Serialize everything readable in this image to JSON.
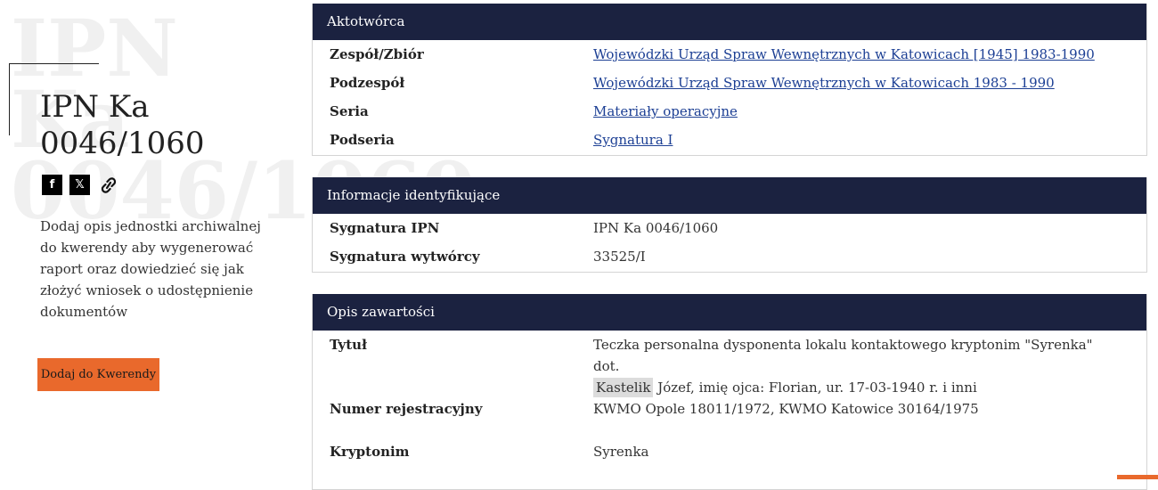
{
  "unit": {
    "watermark": "IPN Ka\n0046/1060",
    "title": "IPN Ka\n0046/1060",
    "description": "Dodaj opis jednostki archiwalnej do kwerendy aby wygenerować raport oraz dowiedzieć się jak złożyć wniosek o udostępnienie dokumentów",
    "add_button": "Dodaj do Kwerendy"
  },
  "share": {
    "facebook_glyph": "f",
    "x_glyph": "𝕏",
    "icons": [
      "facebook-icon",
      "x-icon",
      "link-icon"
    ]
  },
  "creator": {
    "header": "Aktotwórca",
    "rows": [
      {
        "label": "Zespół/Zbiór",
        "value": "Wojewódzki Urząd Spraw Wewnętrznych w Katowicach [1945] 1983-1990"
      },
      {
        "label": "Podzespół",
        "value": "Wojewódzki Urząd Spraw Wewnętrznych w Katowicach 1983 - 1990"
      },
      {
        "label": "Seria",
        "value": "Materiały operacyjne"
      },
      {
        "label": "Podseria",
        "value": "Sygnatura I"
      }
    ]
  },
  "identification": {
    "header": "Informacje identyfikujące",
    "rows": [
      {
        "label": "Sygnatura IPN",
        "value": "IPN Ka 0046/1060"
      },
      {
        "label": "Sygnatura wytwórcy",
        "value": "33525/I"
      }
    ]
  },
  "content": {
    "header": "Opis zawartości",
    "title_label": "Tytuł",
    "title_line1": "Teczka personalna dysponenta lokalu kontaktowego kryptonim \"Syrenka\" dot.",
    "title_highlight": "Kastelik",
    "title_line2": " Józef, imię ojca: Florian, ur. 17-03-1940 r. i inni",
    "registration_label": "Numer rejestracyjny",
    "registration_value": "KWMO Opole 18011/1972, KWMO Katowice 30164/1975",
    "codename_label": "Kryptonim",
    "codename_value": "Syrenka"
  },
  "colors": {
    "header_bg": "#1b2240",
    "accent": "#e9692c",
    "link": "#1c3f94"
  }
}
